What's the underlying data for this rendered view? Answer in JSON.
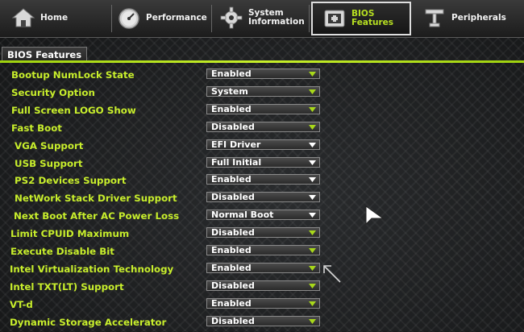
{
  "nav": {
    "tabs": [
      {
        "label": "Home",
        "icon": "home-icon",
        "active": false
      },
      {
        "label": "Performance",
        "icon": "speedometer-icon",
        "active": false
      },
      {
        "label": "System\nInformation",
        "icon": "gear-icon",
        "active": false
      },
      {
        "label": "BIOS\nFeatures",
        "icon": "bios-chip-icon",
        "active": true
      },
      {
        "label": "Peripherals",
        "icon": "peripherals-icon",
        "active": false
      }
    ]
  },
  "section_title": "BIOS Features",
  "colors": {
    "label": "#c8ee2c",
    "accent": "#b7e021",
    "arrow_green": "#a8d81a",
    "arrow_white": "#ffffff"
  },
  "settings": [
    {
      "label": "Bootup NumLock State",
      "value": "Enabled",
      "arrow": "green"
    },
    {
      "label": "Security Option",
      "value": "System",
      "arrow": "green"
    },
    {
      "label": "Full Screen LOGO Show",
      "value": "Enabled",
      "arrow": "green"
    },
    {
      "label": "Fast Boot",
      "value": "Disabled",
      "arrow": "green"
    },
    {
      "label": "VGA Support",
      "value": "EFI Driver",
      "arrow": "white"
    },
    {
      "label": "USB Support",
      "value": "Full Initial",
      "arrow": "white"
    },
    {
      "label": "PS2 Devices Support",
      "value": "Enabled",
      "arrow": "white"
    },
    {
      "label": "NetWork Stack Driver Support",
      "value": "Disabled",
      "arrow": "white"
    },
    {
      "label": "Next Boot After AC Power Loss",
      "value": "Normal Boot",
      "arrow": "white"
    },
    {
      "label": "Limit CPUID Maximum",
      "value": "Disabled",
      "arrow": "green"
    },
    {
      "label": "Execute Disable Bit",
      "value": "Enabled",
      "arrow": "green"
    },
    {
      "label": "Intel Virtualization Technology",
      "value": "Enabled",
      "arrow": "green"
    },
    {
      "label": "Intel TXT(LT) Support",
      "value": "Disabled",
      "arrow": "green"
    },
    {
      "label": "VT-d",
      "value": "Enabled",
      "arrow": "green"
    },
    {
      "label": "Dynamic Storage Accelerator",
      "value": "Disabled",
      "arrow": "green"
    }
  ]
}
